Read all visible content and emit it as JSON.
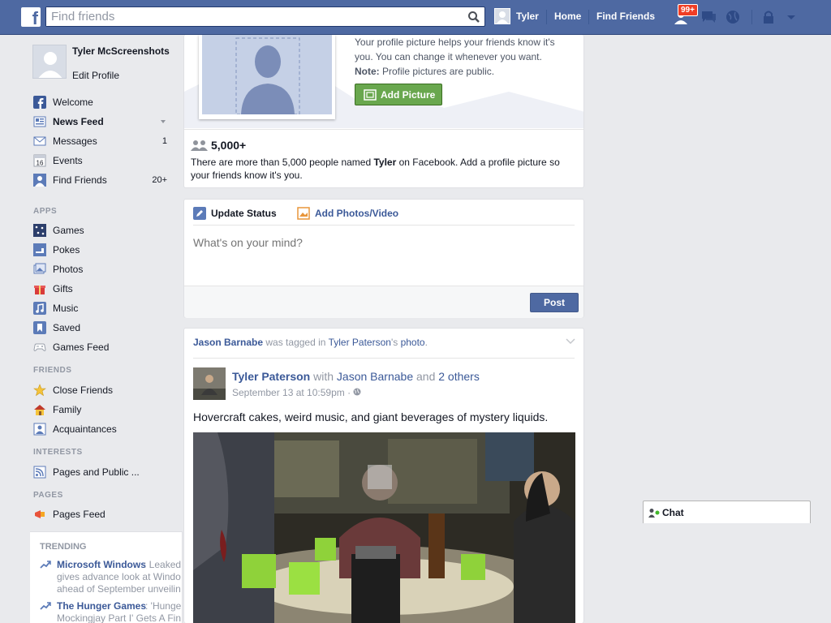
{
  "topbar": {
    "logo": "f",
    "search_placeholder": "Find friends",
    "user_name": "Tyler",
    "home": "Home",
    "find_friends": "Find Friends",
    "requests_badge": "99+"
  },
  "profile": {
    "name": "Tyler McScreenshots",
    "edit": "Edit Profile"
  },
  "favorites": [
    {
      "label": "Welcome",
      "icon": "facebook-icon",
      "count": ""
    },
    {
      "label": "News Feed",
      "icon": "news-feed-icon",
      "count": ""
    },
    {
      "label": "Messages",
      "icon": "messages-icon",
      "count": "1"
    },
    {
      "label": "Events",
      "icon": "calendar-icon",
      "count": ""
    },
    {
      "label": "Find Friends",
      "icon": "find-friends-icon",
      "count": "20+"
    }
  ],
  "apps_header": "APPS",
  "apps": [
    {
      "label": "Games",
      "icon": "games-icon"
    },
    {
      "label": "Pokes",
      "icon": "pokes-icon"
    },
    {
      "label": "Photos",
      "icon": "photos-icon"
    },
    {
      "label": "Gifts",
      "icon": "gift-icon"
    },
    {
      "label": "Music",
      "icon": "music-icon"
    },
    {
      "label": "Saved",
      "icon": "bookmark-icon"
    },
    {
      "label": "Games Feed",
      "icon": "gamepad-icon"
    }
  ],
  "friends_header": "FRIENDS",
  "friends": [
    {
      "label": "Close Friends",
      "icon": "star-icon"
    },
    {
      "label": "Family",
      "icon": "house-icon"
    },
    {
      "label": "Acquaintances",
      "icon": "acquaintances-icon"
    }
  ],
  "interests_header": "INTERESTS",
  "interests": [
    {
      "label": "Pages and Public ...",
      "icon": "rss-icon"
    }
  ],
  "pages_header": "PAGES",
  "pages": [
    {
      "label": "Pages Feed",
      "icon": "megaphone-icon"
    }
  ],
  "trending": {
    "title": "TRENDING",
    "items": [
      {
        "name": "Microsoft Windows",
        "lines": [
          ": Leaked",
          "gives advance look at Windo",
          "ahead of September unveilin"
        ]
      },
      {
        "name": "The Hunger Games",
        "lines": [
          ": 'Hunge",
          "Mockingjay Part I' Gets A Fin"
        ]
      }
    ]
  },
  "profile_prompt": {
    "line1": "Your profile picture helps your friends know it's",
    "line2": "you. You can change it whenever you want.",
    "note_label": "Note:",
    "note_text": " Profile pictures are public.",
    "button": "Add Picture",
    "count": "5,000+",
    "desc_before": "There are more than 5,000 people named ",
    "desc_name": "Tyler",
    "desc_after": " on Facebook. Add a profile picture so your friends know it's you."
  },
  "composer": {
    "update_status": "Update Status",
    "add_photos": "Add Photos/Video",
    "placeholder": "What's on your mind?",
    "post": "Post"
  },
  "story": {
    "actor": "Jason Barnabe",
    "was_tagged": " was tagged in ",
    "owner": "Tyler Paterson",
    "owner_suffix": "'s ",
    "photo": "photo",
    "period": ".",
    "poster": "Tyler Paterson",
    "with": " with ",
    "with_name": "Jason Barnabe",
    "and": " and ",
    "others": "2 others",
    "date": "September 13 at 10:59pm · ",
    "text": "Hovercraft cakes, weird music, and giant beverages of mystery liquids."
  },
  "chat": {
    "label": "Chat"
  },
  "colors": {
    "brand_blue": "#4e69a2",
    "link_blue": "#3b5998",
    "green_button": "#69a74e",
    "badge_red": "#f03d25"
  }
}
